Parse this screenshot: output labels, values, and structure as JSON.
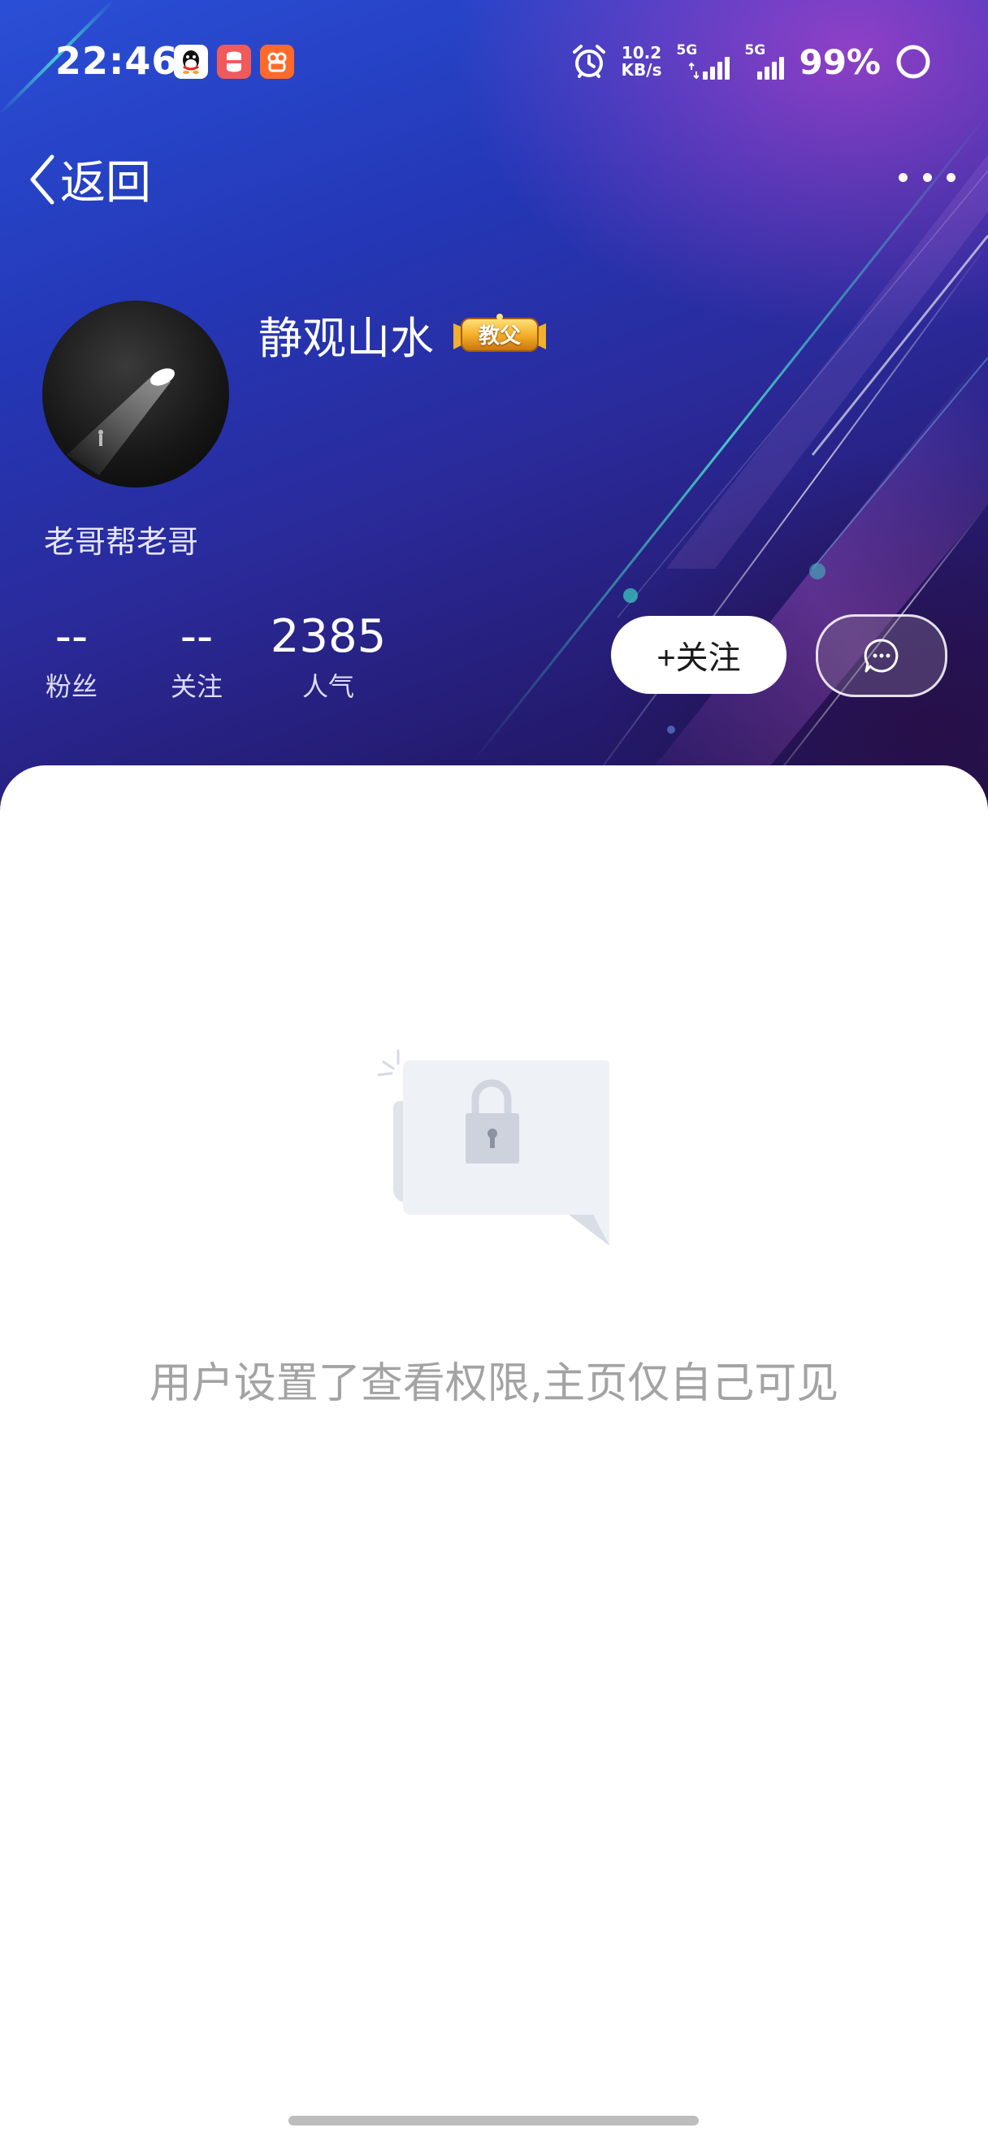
{
  "status_bar": {
    "time": "22:46",
    "net_speed_value": "10.2",
    "net_speed_unit": "KB/s",
    "signal1_tag": "5G",
    "signal2_tag": "5G",
    "battery": "99%",
    "app_icons": [
      "qq-icon",
      "red-cup-app-icon",
      "orange-app-icon"
    ]
  },
  "nav": {
    "back_label": "返回"
  },
  "profile": {
    "username": "静观山水",
    "badge": "教父",
    "bio": "老哥帮老哥"
  },
  "stats": [
    {
      "value": "--",
      "label": "粉丝"
    },
    {
      "value": "--",
      "label": "关注"
    },
    {
      "value": "2385",
      "label": "人气"
    }
  ],
  "actions": {
    "follow_label": "+关注"
  },
  "empty_state": {
    "message": "用户设置了查看权限,主页仅自己可见"
  },
  "colors": {
    "hero_top": "#2a4fd6",
    "hero_bottom": "#1d1450",
    "hero_accent": "#e646d2",
    "badge_gold": "#f0a020",
    "empty_text": "#a3a3a3"
  }
}
